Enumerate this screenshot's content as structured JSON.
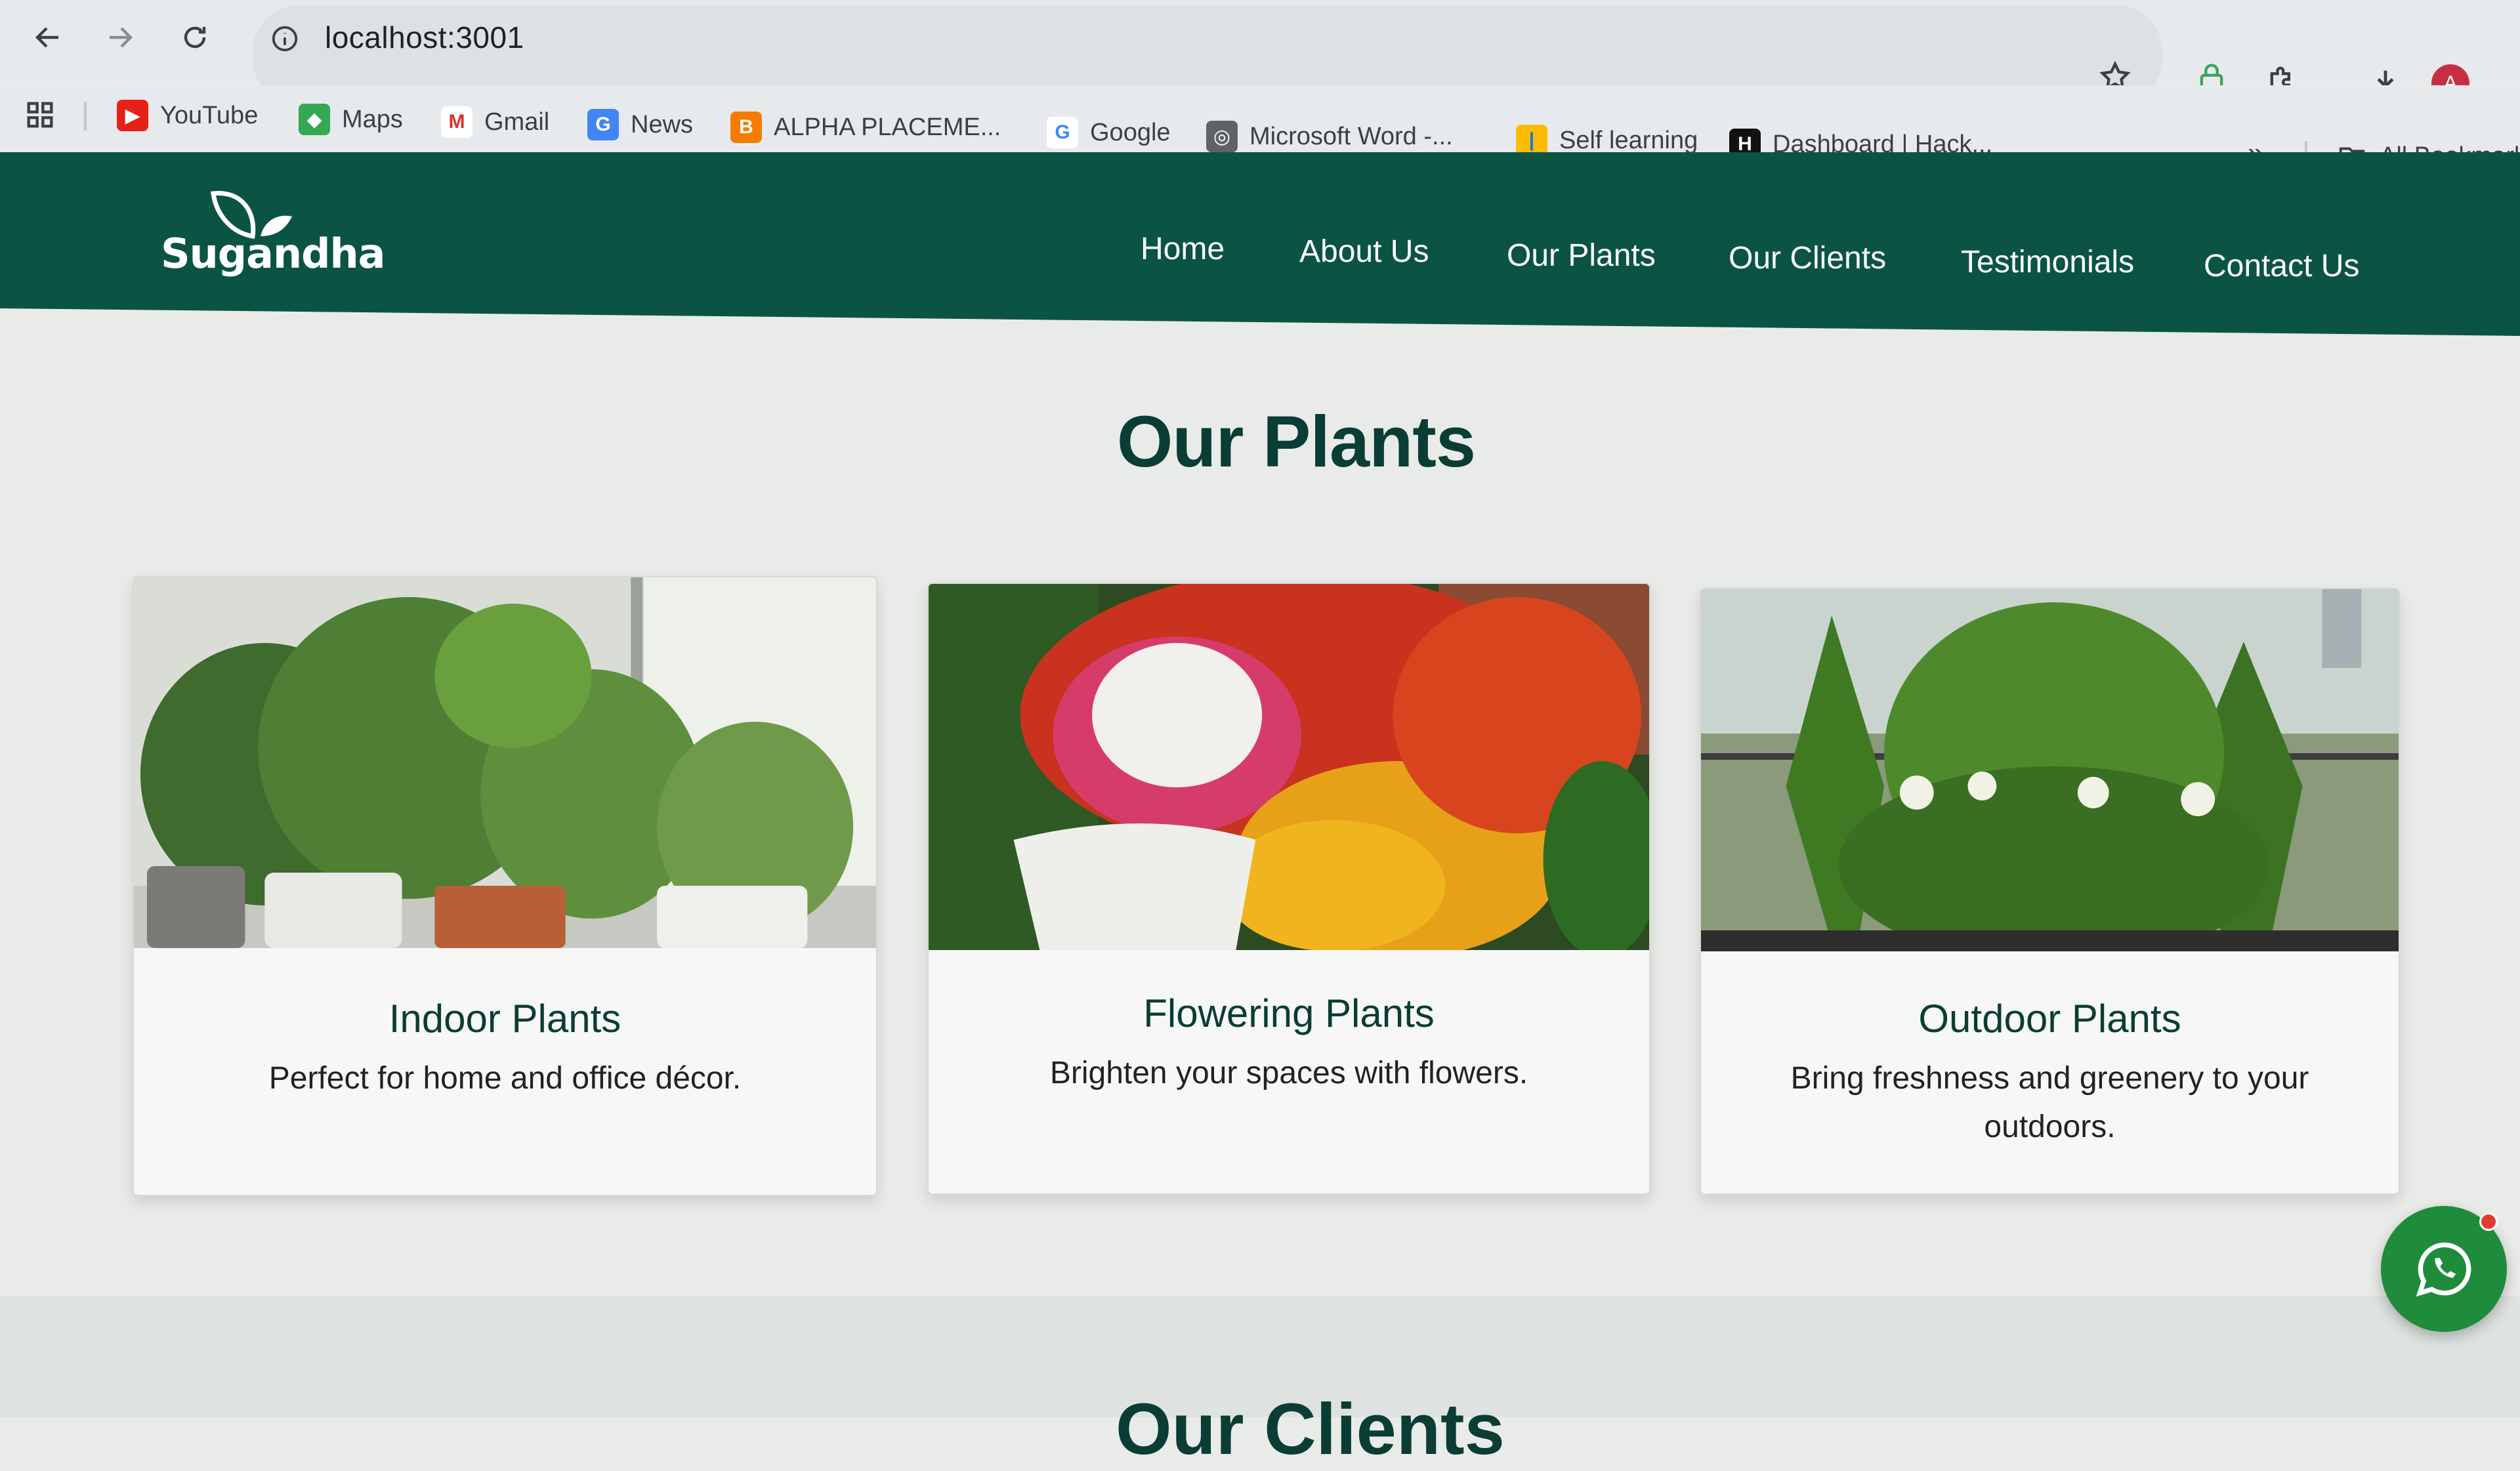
{
  "browser": {
    "url": "localhost:3001",
    "profile_initial": "A",
    "bookmarks": [
      {
        "label": "YouTube",
        "icon": "youtube-icon"
      },
      {
        "label": "Maps",
        "icon": "maps-icon"
      },
      {
        "label": "Gmail",
        "icon": "gmail-icon"
      },
      {
        "label": "News",
        "icon": "news-icon"
      },
      {
        "label": "ALPHA PLACEME...",
        "icon": "blogger-icon"
      },
      {
        "label": "Google",
        "icon": "google-icon"
      },
      {
        "label": "Microsoft Word -...",
        "icon": "globe-icon"
      },
      {
        "label": "Self learning",
        "icon": "bars-icon"
      },
      {
        "label": "Dashboard | Hack...",
        "icon": "hackerrank-icon"
      }
    ],
    "all_bookmarks_label": "All Bookmarks",
    "overflow_label": "»"
  },
  "site": {
    "logo_text": "Sugandha",
    "nav": {
      "home": "Home",
      "about": "About Us",
      "plants": "Our Plants",
      "clients": "Our Clients",
      "testimonials": "Testimonials",
      "contact": "Contact Us"
    },
    "section_title": "Our Plants",
    "cards": [
      {
        "title": "Indoor Plants",
        "description": "Perfect for home and office décor."
      },
      {
        "title": "Flowering Plants",
        "description": "Brighten your spaces with flowers."
      },
      {
        "title": "Outdoor Plants",
        "description": "Bring freshness and greenery to your outdoors."
      }
    ],
    "next_section_title": "Our Clients"
  },
  "colors": {
    "header_bg": "#0b5443",
    "heading": "#0a3d33",
    "whatsapp": "#1e8c3b"
  }
}
